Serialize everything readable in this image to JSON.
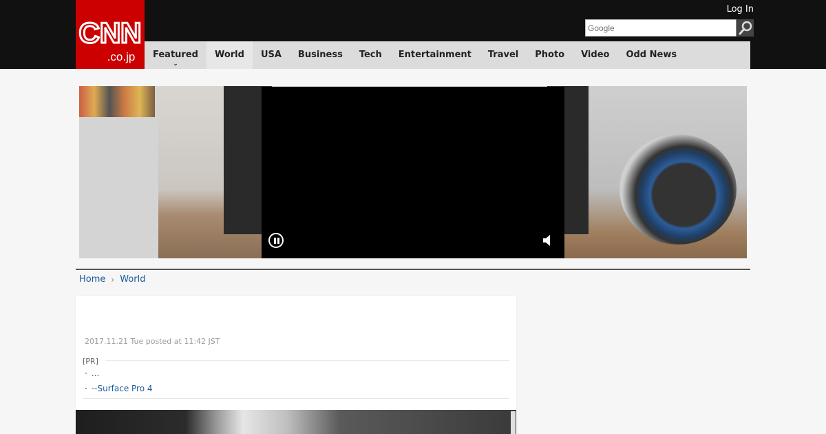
{
  "header": {
    "logo_alt": "CNN.co.jp",
    "login_label": "Log In",
    "search_placeholder": "Google"
  },
  "nav": {
    "items": [
      "Featured",
      "World",
      "USA",
      "Business",
      "Tech",
      "Entertainment",
      "Travel",
      "Photo",
      "Video",
      "Odd News"
    ],
    "active": "World"
  },
  "breadcrumb": {
    "home": "Home",
    "current": "World"
  },
  "article": {
    "date": "2017.11.21 Tue posted at 11:42 JST",
    "pr_label": "[PR]",
    "pr_links": [
      "...",
      "--Surface Pro 4"
    ]
  },
  "colors": {
    "brand_red": "#cc0000",
    "link_blue": "#1a5a9a",
    "topbar": "#111111",
    "nav_bg": "#dcdcdc"
  }
}
